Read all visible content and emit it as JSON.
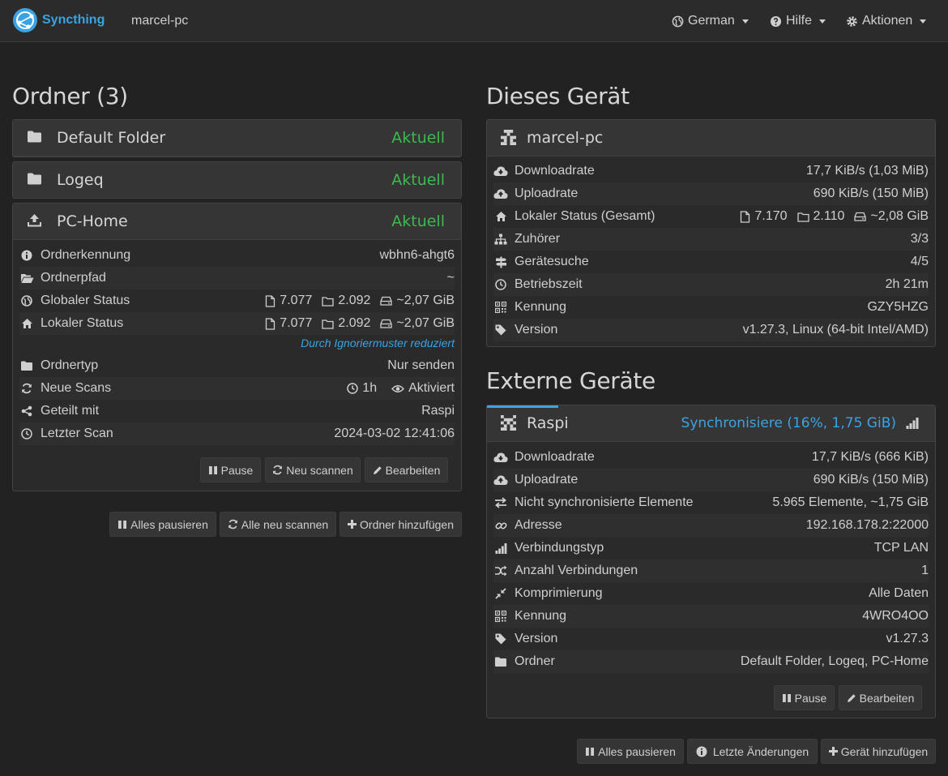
{
  "navbar": {
    "brand": "Syncthing",
    "hostname": "marcel-pc",
    "language": "German",
    "help": "Hilfe",
    "actions": "Aktionen"
  },
  "folders": {
    "heading": "Ordner (3)",
    "items": [
      {
        "name": "Default Folder",
        "status": "Aktuell"
      },
      {
        "name": "Logeq",
        "status": "Aktuell"
      },
      {
        "name": "PC-Home",
        "status": "Aktuell"
      }
    ],
    "details": {
      "id_label": "Ordnerkennung",
      "id_value": "wbhn6-ahgt6",
      "path_label": "Ordnerpfad",
      "path_value": "~",
      "global_label": "Globaler Status",
      "global_files": "7.077",
      "global_dirs": "2.092",
      "global_size": "~2,07 GiB",
      "local_label": "Lokaler Status",
      "local_files": "7.077",
      "local_dirs": "2.092",
      "local_size": "~2,07 GiB",
      "ignore_note": "Durch Ignoriermuster reduziert",
      "type_label": "Ordnertyp",
      "type_value": "Nur senden",
      "rescan_label": "Neue Scans",
      "rescan_interval": "1h",
      "rescan_watch": "Aktiviert",
      "shared_label": "Geteilt mit",
      "shared_value": "Raspi",
      "lastscan_label": "Letzter Scan",
      "lastscan_value": "2024-03-02 12:41:06"
    },
    "buttons": {
      "pause": "Pause",
      "rescan": "Neu scannen",
      "edit": "Bearbeiten"
    },
    "footer": {
      "pause_all": "Alles pausieren",
      "rescan_all": "Alle neu scannen",
      "add": "Ordner hinzufügen"
    }
  },
  "this_device": {
    "heading": "Dieses Gerät",
    "name": "marcel-pc",
    "download_label": "Downloadrate",
    "download_value": "17,7 KiB/s (1,03 MiB)",
    "upload_label": "Uploadrate",
    "upload_value": "690 KiB/s (150 MiB)",
    "local_label": "Lokaler Status (Gesamt)",
    "local_files": "7.170",
    "local_dirs": "2.110",
    "local_size": "~2,08 GiB",
    "listeners_label": "Zuhörer",
    "listeners_value": "3/3",
    "discovery_label": "Gerätesuche",
    "discovery_value": "4/5",
    "uptime_label": "Betriebszeit",
    "uptime_value": "2h 21m",
    "id_label": "Kennung",
    "id_value": "GZY5HZG",
    "version_label": "Version",
    "version_value": "v1.27.3, Linux (64-bit Intel/AMD)"
  },
  "remote_devices": {
    "heading": "Externe Geräte",
    "name": "Raspi",
    "status": "Synchronisiere (16%, 1,75 GiB)",
    "sync_progress": 0.16,
    "download_label": "Downloadrate",
    "download_value": "17,7 KiB/s (666 KiB)",
    "upload_label": "Uploadrate",
    "upload_value": "690 KiB/s (150 MiB)",
    "outofsync_label": "Nicht synchronisierte Elemente",
    "outofsync_value": "5.965 Elemente, ~1,75 GiB",
    "address_label": "Adresse",
    "address_value": "192.168.178.2:22000",
    "conntype_label": "Verbindungstyp",
    "conntype_value": "TCP LAN",
    "conncount_label": "Anzahl Verbindungen",
    "conncount_value": "1",
    "compression_label": "Komprimierung",
    "compression_value": "Alle Daten",
    "id_label": "Kennung",
    "id_value": "4WRO4OO",
    "version_label": "Version",
    "version_value": "v1.27.3",
    "folders_label": "Ordner",
    "folders_value": "Default Folder, Logeq, PC-Home",
    "buttons": {
      "pause": "Pause",
      "edit": "Bearbeiten"
    },
    "footer": {
      "pause_all": "Alles pausieren",
      "recent_changes": "Letzte Änderungen",
      "add": "Gerät hinzufügen"
    }
  },
  "colors": {
    "accent": "#3aa3e3",
    "ok": "#3fb850",
    "background": "#222222"
  }
}
